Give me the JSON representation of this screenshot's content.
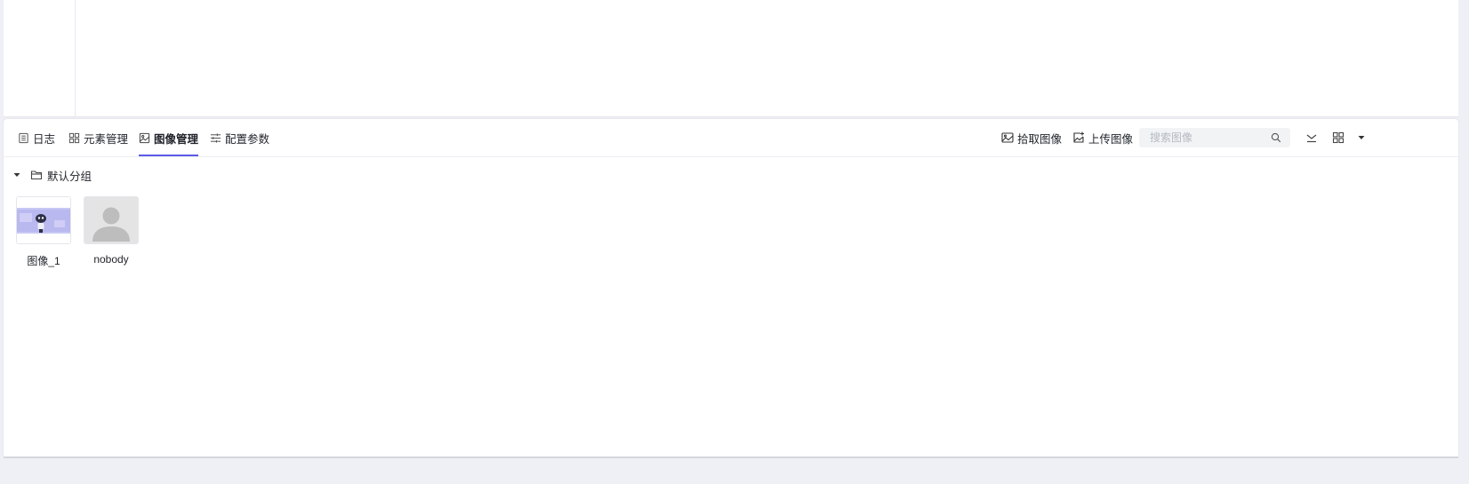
{
  "tabs": [
    {
      "id": "log",
      "label": "日志",
      "icon": "list-icon",
      "active": false
    },
    {
      "id": "elements",
      "label": "元素管理",
      "icon": "grid-icon",
      "active": false
    },
    {
      "id": "images",
      "label": "图像管理",
      "icon": "image-icon",
      "active": true
    },
    {
      "id": "config",
      "label": "配置参数",
      "icon": "sliders-icon",
      "active": false
    }
  ],
  "toolbar": {
    "pick_label": "拾取图像",
    "upload_label": "上传图像",
    "search_placeholder": "搜索图像"
  },
  "group": {
    "name": "默认分组",
    "expanded": true
  },
  "images": [
    {
      "name": "图像_1",
      "thumb": "robot-thumbnail"
    },
    {
      "name": "nobody",
      "thumb": "default-avatar"
    }
  ],
  "colors": {
    "accent": "#5b5ce6",
    "border": "#e4e6eb",
    "search_bg": "#f2f3f5"
  }
}
